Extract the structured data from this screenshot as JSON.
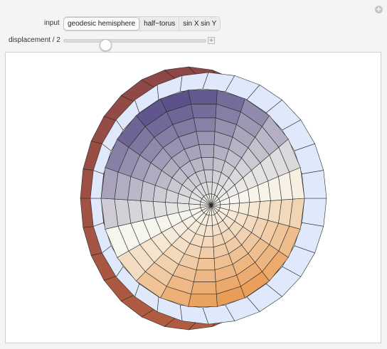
{
  "controls": {
    "input_label": "input",
    "input_options": [
      "geodesic hemisphere",
      "half−torus",
      "sin X sin Y"
    ],
    "selected_option": "geodesic hemisphere",
    "slider_label": "displacement / 2",
    "slider_value_fraction": 0.27,
    "corner_icon": "plus-circle-icon",
    "slider_expand_icon": "plus-square-icon"
  },
  "plot": {
    "object": "geodesic hemisphere with offset rim band",
    "colors": {
      "rim_band": "#dfe9fb",
      "outer_shell_dark": "#7a3c48",
      "outer_shell_light": "#c4673f",
      "gradient_top": "#5a4f88",
      "gradient_mid": "#f8f7ef",
      "gradient_bottom": "#e99a52"
    }
  }
}
